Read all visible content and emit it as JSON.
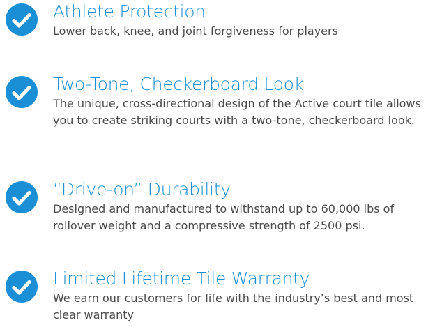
{
  "colors": {
    "accent": "#1b8fd6",
    "check_fill": "#1b8fd6",
    "title_text": "#1b8fd6",
    "body_text": "#4a4a4a",
    "background": "#ffffff"
  },
  "features": [
    {
      "icon": "check-circle-icon",
      "title": "Athlete Protection",
      "description": "Lower back, knee, and joint forgiveness for players"
    },
    {
      "icon": "check-circle-icon",
      "title": "Two-Tone, Checkerboard Look",
      "description": "The unique, cross-directional design of the Active court tile allows you to create striking courts with a two-tone, checkerboard look."
    },
    {
      "icon": "check-circle-icon",
      "title": "“Drive-on” Durability",
      "description": "Designed and manufactured to withstand up to 60,000 lbs of rollover weight and a compressive strength of 2500 psi."
    },
    {
      "icon": "check-circle-icon",
      "title": "Limited Lifetime Tile Warranty",
      "description": "We earn our customers for life with the industry’s best and most clear warranty"
    }
  ]
}
